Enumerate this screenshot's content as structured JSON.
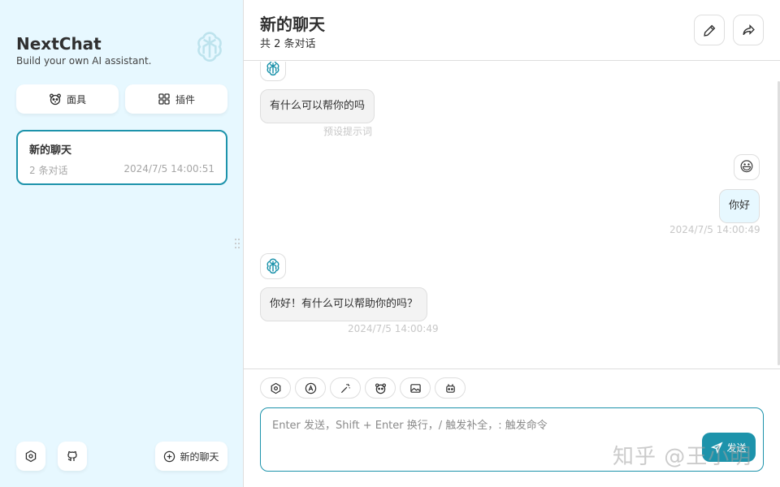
{
  "sidebar": {
    "title": "NextChat",
    "subtitle": "Build your own AI assistant.",
    "mask_button": "面具",
    "plugin_button": "插件",
    "chat_item": {
      "title": "新的聊天",
      "count": "2 条对话",
      "date": "2024/7/5 14:00:51"
    },
    "new_chat_button": "新的聊天"
  },
  "header": {
    "title": "新的聊天",
    "subtitle": "共 2 条对话"
  },
  "messages": [
    {
      "role": "bot",
      "text": "有什么可以帮你的吗",
      "meta": "预设提示词"
    },
    {
      "role": "user",
      "avatar": "😃",
      "text": "你好",
      "meta": "2024/7/5 14:00:49"
    },
    {
      "role": "bot",
      "text": "你好！有什么可以帮助你的吗？",
      "meta": "2024/7/5 14:00:49"
    }
  ],
  "input": {
    "placeholder": "Enter 发送，Shift + Enter 换行，/ 触发补全，: 触发命令",
    "send_label": "发送"
  },
  "watermark": "知乎 @王小明",
  "colors": {
    "accent": "#1d93ab",
    "sidebar_bg": "#e7f8ff",
    "bot_bubble": "#f3f3f3",
    "user_bubble": "#e7f8ff"
  },
  "icons": [
    "openai-logo-icon",
    "mask-icon",
    "plugin-grid-icon",
    "settings-icon",
    "github-icon",
    "add-circle-icon",
    "edit-icon",
    "share-icon",
    "settings-icon",
    "text-style-icon",
    "magic-wand-icon",
    "mask-icon",
    "image-icon",
    "robot-icon",
    "send-icon"
  ]
}
